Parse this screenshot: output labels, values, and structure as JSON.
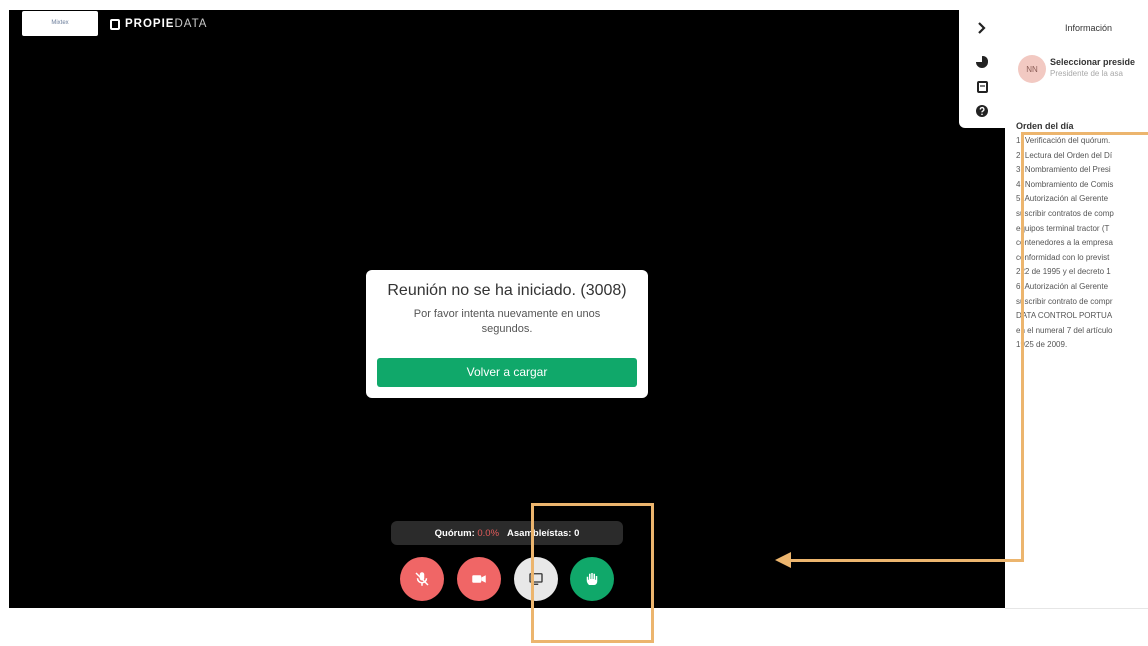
{
  "header": {
    "logo_text": "Mixtex",
    "brand_bold": "PROPIE",
    "brand_light": "DATA"
  },
  "dialog": {
    "title": "Reunión no se ha iniciado. (3008)",
    "message": "Por favor intenta nuevamente en unos segundos.",
    "reload_label": "Volver a cargar"
  },
  "status": {
    "quorum_label": "Quórum:",
    "quorum_value": "0.0%",
    "assembly_label": "Asambleístas: 0"
  },
  "controls": [
    "mic-off-icon",
    "video-off-icon",
    "screen-share-icon",
    "raise-hand-icon"
  ],
  "sidebar": {
    "icons": [
      "chevron-right-icon",
      "chart-icon",
      "document-icon",
      "help-icon"
    ]
  },
  "panel": {
    "title": "Información",
    "avatar_initials": "NN",
    "president_name": "Seleccionar preside",
    "president_role": "Presidente de la asa",
    "agenda_title": "Orden del día",
    "agenda_lines": [
      "1. Verificación del quórum.",
      "2. Lectura del Orden del Dí",
      "3. Nombramiento del Presi",
      "4. Nombramiento de Comis",
      "5. Autorización al Gerente",
      "suscribir contratos de comp",
      "equipos terminal tractor (T",
      "contenedores a la empresa",
      "conformidad con lo previst",
      "222 de 1995 y el decreto 1",
      "6. Autorización al Gerente",
      "suscribir contrato de compr",
      "DATA CONTROL PORTUA",
      "en el numeral 7 del artículo",
      "1925 de 2009."
    ]
  },
  "colors": {
    "accent_green": "#10a86a",
    "danger_red": "#f06666",
    "highlight": "#ecb56e"
  }
}
